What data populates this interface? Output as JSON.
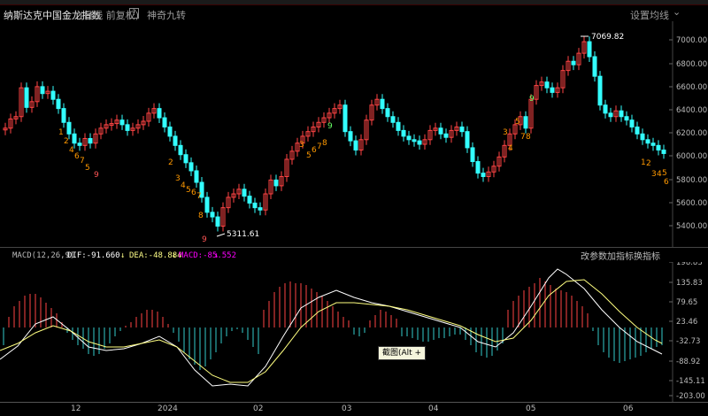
{
  "header": {
    "title": "纳斯达克中国金龙指数",
    "subtitle": "(日线 前复权)",
    "question": "?",
    "indicator": "神奇九转",
    "setting": "设置均线",
    "chevron": "⌄"
  },
  "price_axis": [
    "7000.00",
    "6800.00",
    "6600.00",
    "6400.00",
    "6200.00",
    "6000.00",
    "5800.00",
    "5600.00",
    "5400.00"
  ],
  "price_annotations": {
    "high": "7069.82",
    "low": "5311.61"
  },
  "macd": {
    "name": "MACD(12,26,9)",
    "dif": "DIF:-91.660",
    "dea": "DEA:-48.884",
    "macd": "MACD:-85.552",
    "arrow": "↓",
    "buttons": [
      "改参数",
      "加指标",
      "换指标"
    ],
    "axis": [
      "198.83",
      "135.83",
      "79.65",
      "23.46",
      "-32.73",
      "-88.92",
      "-145.11",
      "-203.00"
    ]
  },
  "tooltip": "截图(Alt + A)",
  "x_axis": [
    "12",
    "2024",
    "02",
    "03",
    "04",
    "05",
    "06"
  ],
  "colors": {
    "up": "#f44",
    "down": "#3ff",
    "dif": "#ffffff",
    "dea": "#ffff80",
    "macd": "#ff00ff"
  },
  "chart_data": {
    "type": "candlestick",
    "y_range": [
      5311.61,
      7069.82
    ],
    "high_value": 7069.82,
    "low_value": 5311.61,
    "series": [
      {
        "name": "DIF",
        "value": -91.66
      },
      {
        "name": "DEA",
        "value": -48.884
      },
      {
        "name": "MACD",
        "value": -85.552
      }
    ]
  }
}
